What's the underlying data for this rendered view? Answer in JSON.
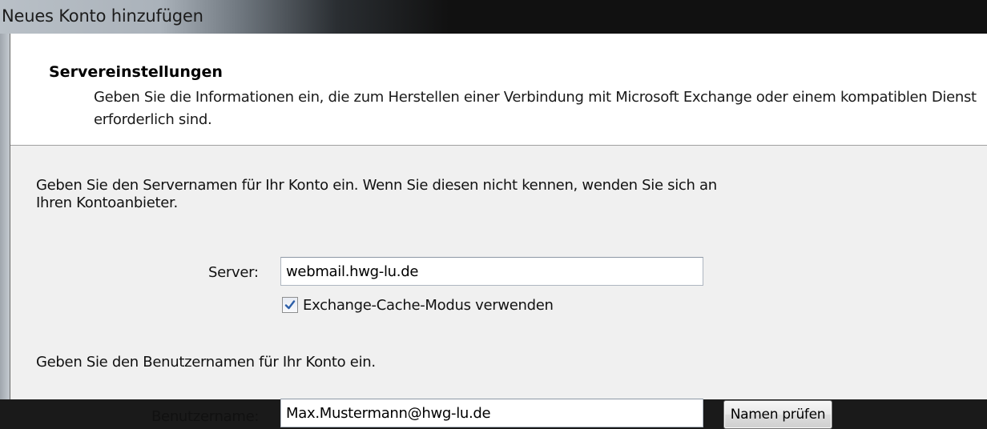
{
  "window": {
    "title": "Neues Konto hinzufügen"
  },
  "header": {
    "title": "Servereinstellungen",
    "description": "Geben Sie die Informationen ein, die zum Herstellen einer Verbindung mit Microsoft Exchange oder einem kompatiblen Dienst erforderlich sind."
  },
  "server_section": {
    "intro": "Geben Sie den Servernamen für Ihr Konto ein. Wenn Sie diesen nicht kennen, wenden Sie sich an Ihren Kontoanbieter.",
    "server_label": "Server:",
    "server_value": "webmail.hwg-lu.de",
    "cache_mode_label": "Exchange-Cache-Modus verwenden",
    "cache_mode_checked": true
  },
  "user_section": {
    "intro": "Geben Sie den Benutzernamen für Ihr Konto ein.",
    "username_label": "Benutzername:",
    "username_value": "Max.Mustermann@hwg-lu.de",
    "check_name_button": "Namen prüfen"
  },
  "icons": {
    "checkbox_mark": "check-icon"
  },
  "colors": {
    "checkmark": "#2c5ea8",
    "dialog_background": "#f0f0f0",
    "header_background": "#ffffff"
  }
}
